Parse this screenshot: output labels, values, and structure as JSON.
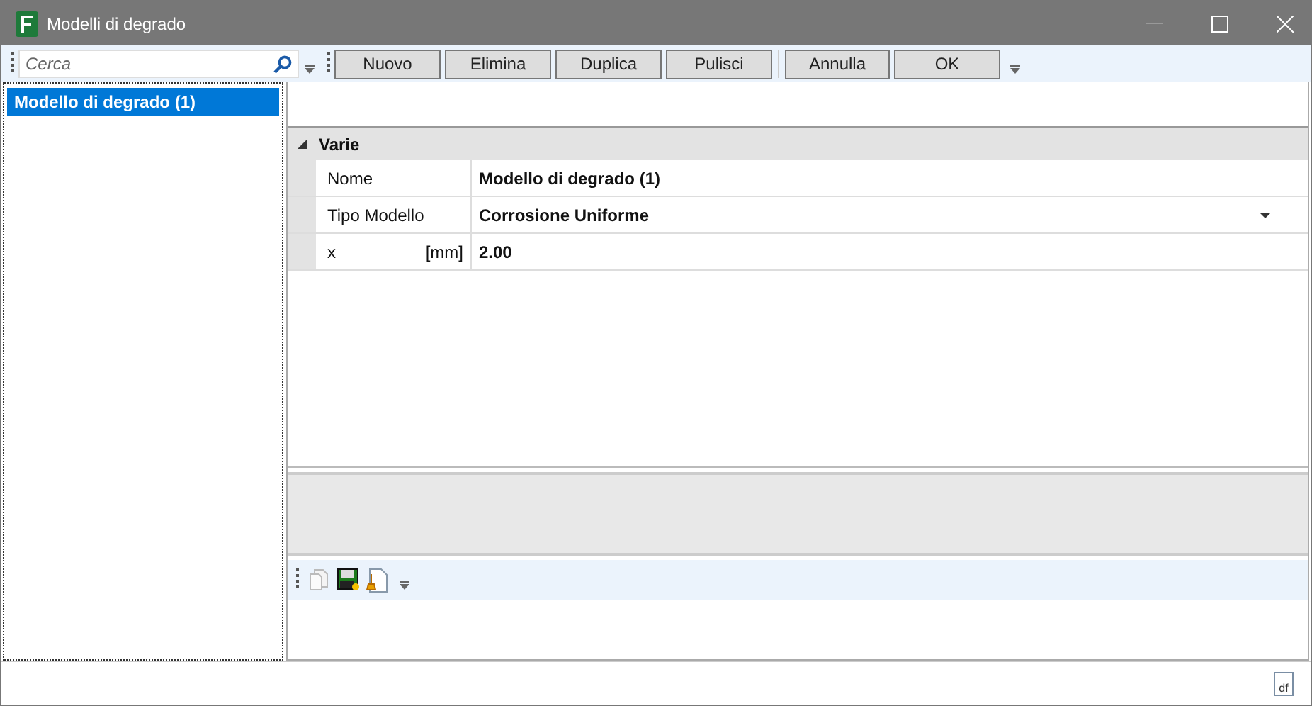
{
  "window": {
    "title": "Modelli di degrado"
  },
  "search": {
    "placeholder": "Cerca"
  },
  "toolbar": {
    "buttons": [
      {
        "label": "Nuovo"
      },
      {
        "label": "Elimina"
      },
      {
        "label": "Duplica"
      },
      {
        "label": "Pulisci"
      }
    ],
    "dialog_buttons": [
      {
        "label": "Annulla"
      },
      {
        "label": "OK"
      }
    ]
  },
  "sidebar": {
    "items": [
      {
        "label": "Modello di degrado (1)",
        "selected": true
      }
    ]
  },
  "property_grid": {
    "category": {
      "label": "Varie",
      "expanded": true
    },
    "rows": [
      {
        "kind": "text",
        "name": "Nome",
        "value": "Modello di degrado (1)"
      },
      {
        "kind": "dropdown",
        "name": "Tipo Modello",
        "value": "Corrosione Uniforme"
      },
      {
        "kind": "unit",
        "name": "x",
        "unit": "[mm]",
        "value": "2.00"
      }
    ]
  },
  "status_bar": {
    "file_icon_text": "df"
  }
}
